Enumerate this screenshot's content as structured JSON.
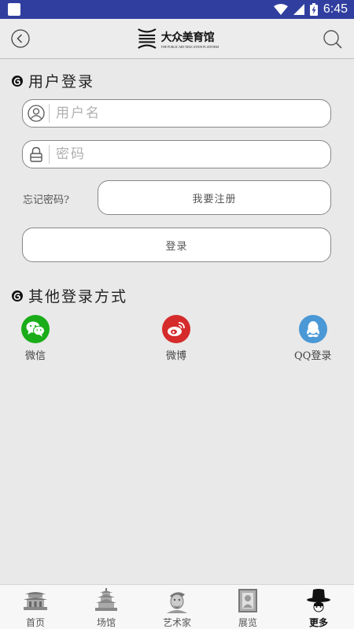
{
  "status_bar": {
    "time": "6:45"
  },
  "header": {
    "logo_title": "大众美育馆",
    "logo_subtitle": "THE PUBLIC ART EDUCATION PLATFORM",
    "back_icon": "back-circle-icon",
    "search_icon": "search-icon"
  },
  "login": {
    "section_title": "用户登录",
    "username_placeholder": "用户名",
    "password_placeholder": "密码",
    "forgot_label": "忘记密码?",
    "register_label": "我要注册",
    "login_label": "登录"
  },
  "other_login": {
    "section_title": "其他登录方式",
    "methods": [
      {
        "label": "微信",
        "icon": "wechat-icon",
        "color": "#1aad19"
      },
      {
        "label": "微博",
        "icon": "weibo-icon",
        "color": "#d52b2b"
      },
      {
        "label": "QQ登录",
        "icon": "qq-icon",
        "color": "#4a98d6"
      }
    ]
  },
  "bottom_nav": {
    "items": [
      {
        "label": "首页",
        "icon": "temple-icon"
      },
      {
        "label": "场馆",
        "icon": "pagoda-icon"
      },
      {
        "label": "艺术家",
        "icon": "artist-icon"
      },
      {
        "label": "展览",
        "icon": "painting-frame-icon"
      },
      {
        "label": "更多",
        "icon": "top-hat-icon"
      }
    ],
    "active_index": 4
  },
  "colors": {
    "status_bar": "#303f9f",
    "background": "#e9e9e9"
  }
}
